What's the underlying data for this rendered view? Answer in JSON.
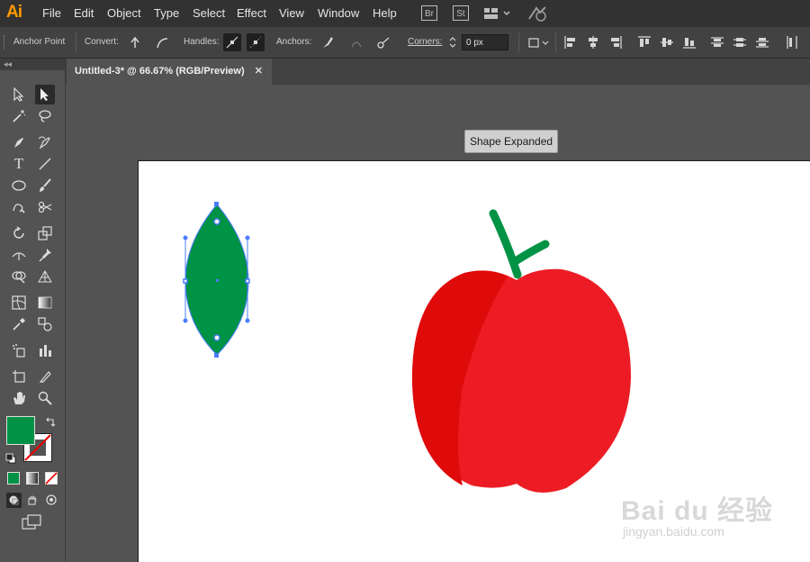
{
  "app": {
    "logo": "Ai"
  },
  "menu": [
    "File",
    "Edit",
    "Object",
    "Type",
    "Select",
    "Effect",
    "View",
    "Window",
    "Help"
  ],
  "menubar_icons": {
    "bridge": "Br",
    "stock": "St"
  },
  "control_bar": {
    "anchor_point": "Anchor Point",
    "convert": "Convert:",
    "handles": "Handles:",
    "anchors": "Anchors:",
    "corners": "Corners:",
    "corners_value": "0 px"
  },
  "document_tab": {
    "title": "Untitled-3* @ 66.67% (RGB/Preview)",
    "close": "✕"
  },
  "tooltip": "Shape Expanded",
  "toolbar": {
    "collapse": "◂◂"
  },
  "colors": {
    "fill": "#009245",
    "leaf": "#009245",
    "apple_light": "#ed1c24",
    "apple_dark": "#df0a0a",
    "stem": "#009245",
    "selection": "#4a7cff"
  },
  "watermark": {
    "brand": "Bai du 经验",
    "url": "jingyan.baidu.com"
  }
}
